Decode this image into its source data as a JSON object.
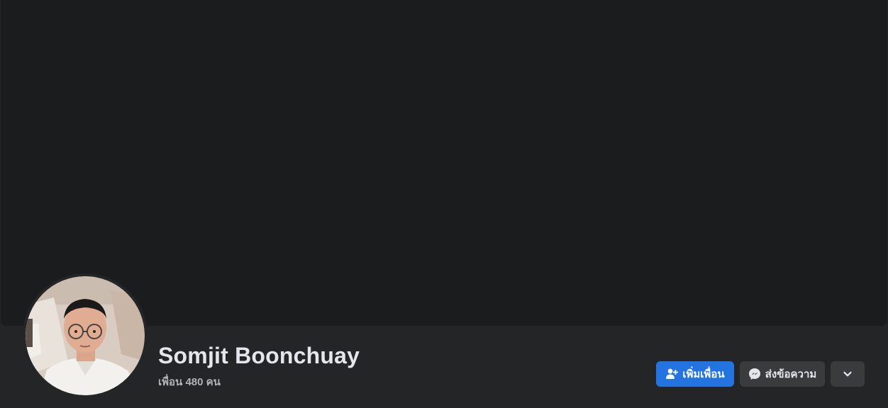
{
  "profile": {
    "name": "Somjit Boonchuay",
    "friends_text": "เพื่อน 480 คน"
  },
  "actions": {
    "add_friend_label": "เพิ่มเพื่อน",
    "message_label": "ส่งข้อความ"
  },
  "icons": {
    "add_friend": "add-friend-icon",
    "messenger": "messenger-icon",
    "more": "chevron-down-icon"
  },
  "colors": {
    "background": "#242526",
    "cover": "#1b1c1e",
    "primary_button": "#2374e1",
    "secondary_button": "#3a3b3c",
    "name_text": "#e4e6eb",
    "secondary_text": "#b0b3b8"
  }
}
